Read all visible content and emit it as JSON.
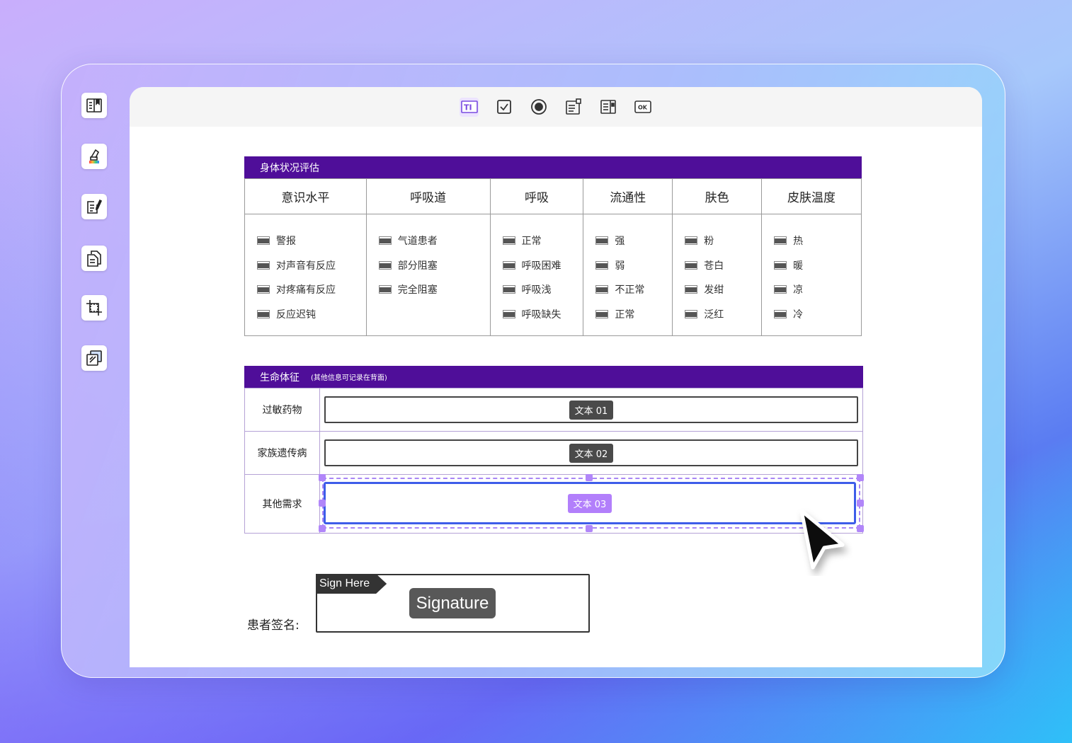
{
  "sidebar": {
    "icons": [
      {
        "name": "document-icon"
      },
      {
        "name": "highlighter-icon"
      },
      {
        "name": "edit-document-icon"
      },
      {
        "name": "copy-document-icon"
      },
      {
        "name": "crop-icon"
      },
      {
        "name": "layers-icon"
      }
    ]
  },
  "toolbar": {
    "tools": [
      {
        "name": "text-field-icon",
        "glyph": "TI",
        "active": true
      },
      {
        "name": "checkbox-icon"
      },
      {
        "name": "radio-button-icon"
      },
      {
        "name": "combo-box-icon"
      },
      {
        "name": "list-box-icon"
      },
      {
        "name": "button-field-icon",
        "glyph": "OK"
      }
    ]
  },
  "assessment": {
    "title": "身体状况评估",
    "columns": [
      {
        "header": "意识水平",
        "options": [
          "警报",
          "对声音有反应",
          "对疼痛有反应",
          "反应迟钝"
        ]
      },
      {
        "header": "呼吸道",
        "options": [
          "气道患者",
          "部分阻塞",
          "完全阻塞"
        ]
      },
      {
        "header": "呼吸",
        "options": [
          "正常",
          "呼吸困难",
          "呼吸浅",
          "呼吸缺失"
        ]
      },
      {
        "header": "流通性",
        "options": [
          "强",
          "弱",
          "不正常",
          "正常"
        ]
      },
      {
        "header": "肤色",
        "options": [
          "粉",
          "苍白",
          "发绀",
          "泛红"
        ]
      },
      {
        "header": "皮肤温度",
        "options": [
          "热",
          "暖",
          "凉",
          "冷"
        ]
      }
    ]
  },
  "vitals": {
    "title": "生命体征",
    "subtitle": "(其他信息可记录在背面)",
    "rows": [
      {
        "label": "过敏药物",
        "field": "文本 01"
      },
      {
        "label": "家族遗传病",
        "field": "文本 02"
      },
      {
        "label": "其他需求",
        "field": "文本 03"
      }
    ]
  },
  "signature": {
    "label": "患者签名:",
    "flag": "Sign Here",
    "badge": "Signature"
  },
  "colors": {
    "section_header": "#4f0e99",
    "selection_border": "#3e5de9",
    "selection_handle": "#b186f9"
  }
}
